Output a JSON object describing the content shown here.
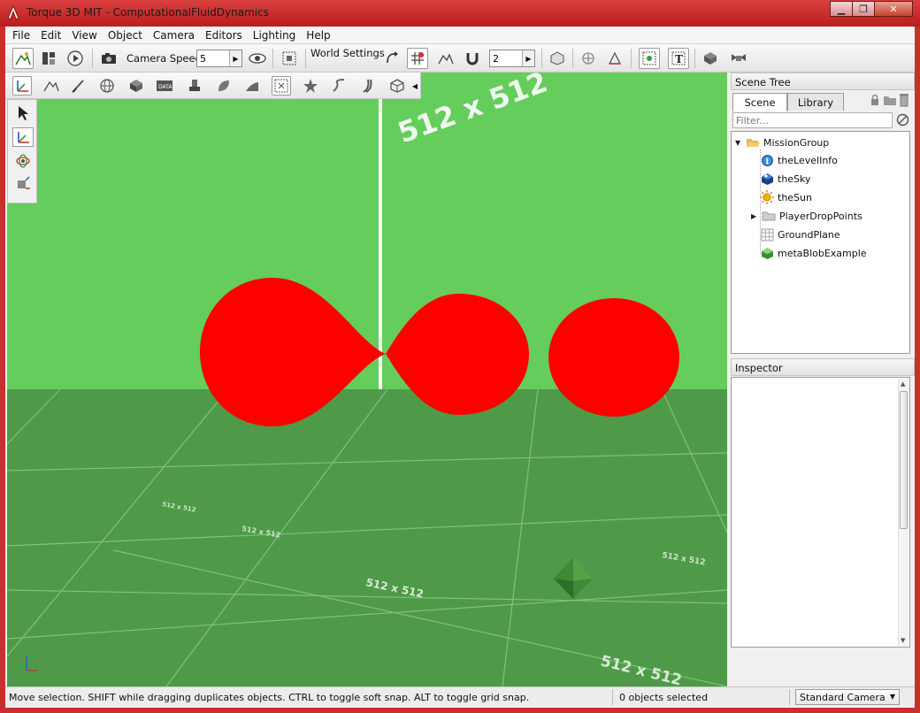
{
  "window": {
    "title": "Torque 3D MIT - ComputationalFluidDynamics",
    "minimize_glyph": "▁",
    "maximize_glyph": "❐",
    "close_glyph": "✕"
  },
  "menu": [
    "File",
    "Edit",
    "View",
    "Object",
    "Camera",
    "Editors",
    "Lighting",
    "Help"
  ],
  "toolbar": {
    "camera_speed_label": "Camera Speed",
    "camera_speed_value": "5",
    "world_settings_label": "World Settings",
    "grid_size_value": "2"
  },
  "viewport": {
    "grid_labels": [
      "512 x 512",
      "512 x 512",
      "512 x 512",
      "512 x 512",
      "512 x 512",
      "512 x 512"
    ],
    "sky_color": "#65cd5c",
    "ground_color": "#4f9a48",
    "blob_color": "#ff0000"
  },
  "scene_tree": {
    "header": "Scene Tree",
    "tabs": [
      "Scene",
      "Library"
    ],
    "filter_placeholder": "Filter...",
    "items": [
      {
        "label": "MissionGroup",
        "icon": "folder-open-icon"
      },
      {
        "label": "theLevelInfo",
        "icon": "info-icon"
      },
      {
        "label": "theSky",
        "icon": "sky-icon"
      },
      {
        "label": "theSun",
        "icon": "sun-icon"
      },
      {
        "label": "PlayerDropPoints",
        "icon": "folder-icon"
      },
      {
        "label": "GroundPlane",
        "icon": "grid-icon"
      },
      {
        "label": "metaBlobExample",
        "icon": "mesh-icon"
      }
    ]
  },
  "inspector": {
    "header": "Inspector"
  },
  "status": {
    "message": "Move selection.  SHIFT while dragging duplicates objects.  CTRL to toggle soft snap.  ALT to toggle grid snap.",
    "selection": "0 objects selected",
    "camera": "Standard Camera"
  },
  "colors": {
    "titlebar": "#c9302c",
    "accent": "#1a5fb4"
  }
}
